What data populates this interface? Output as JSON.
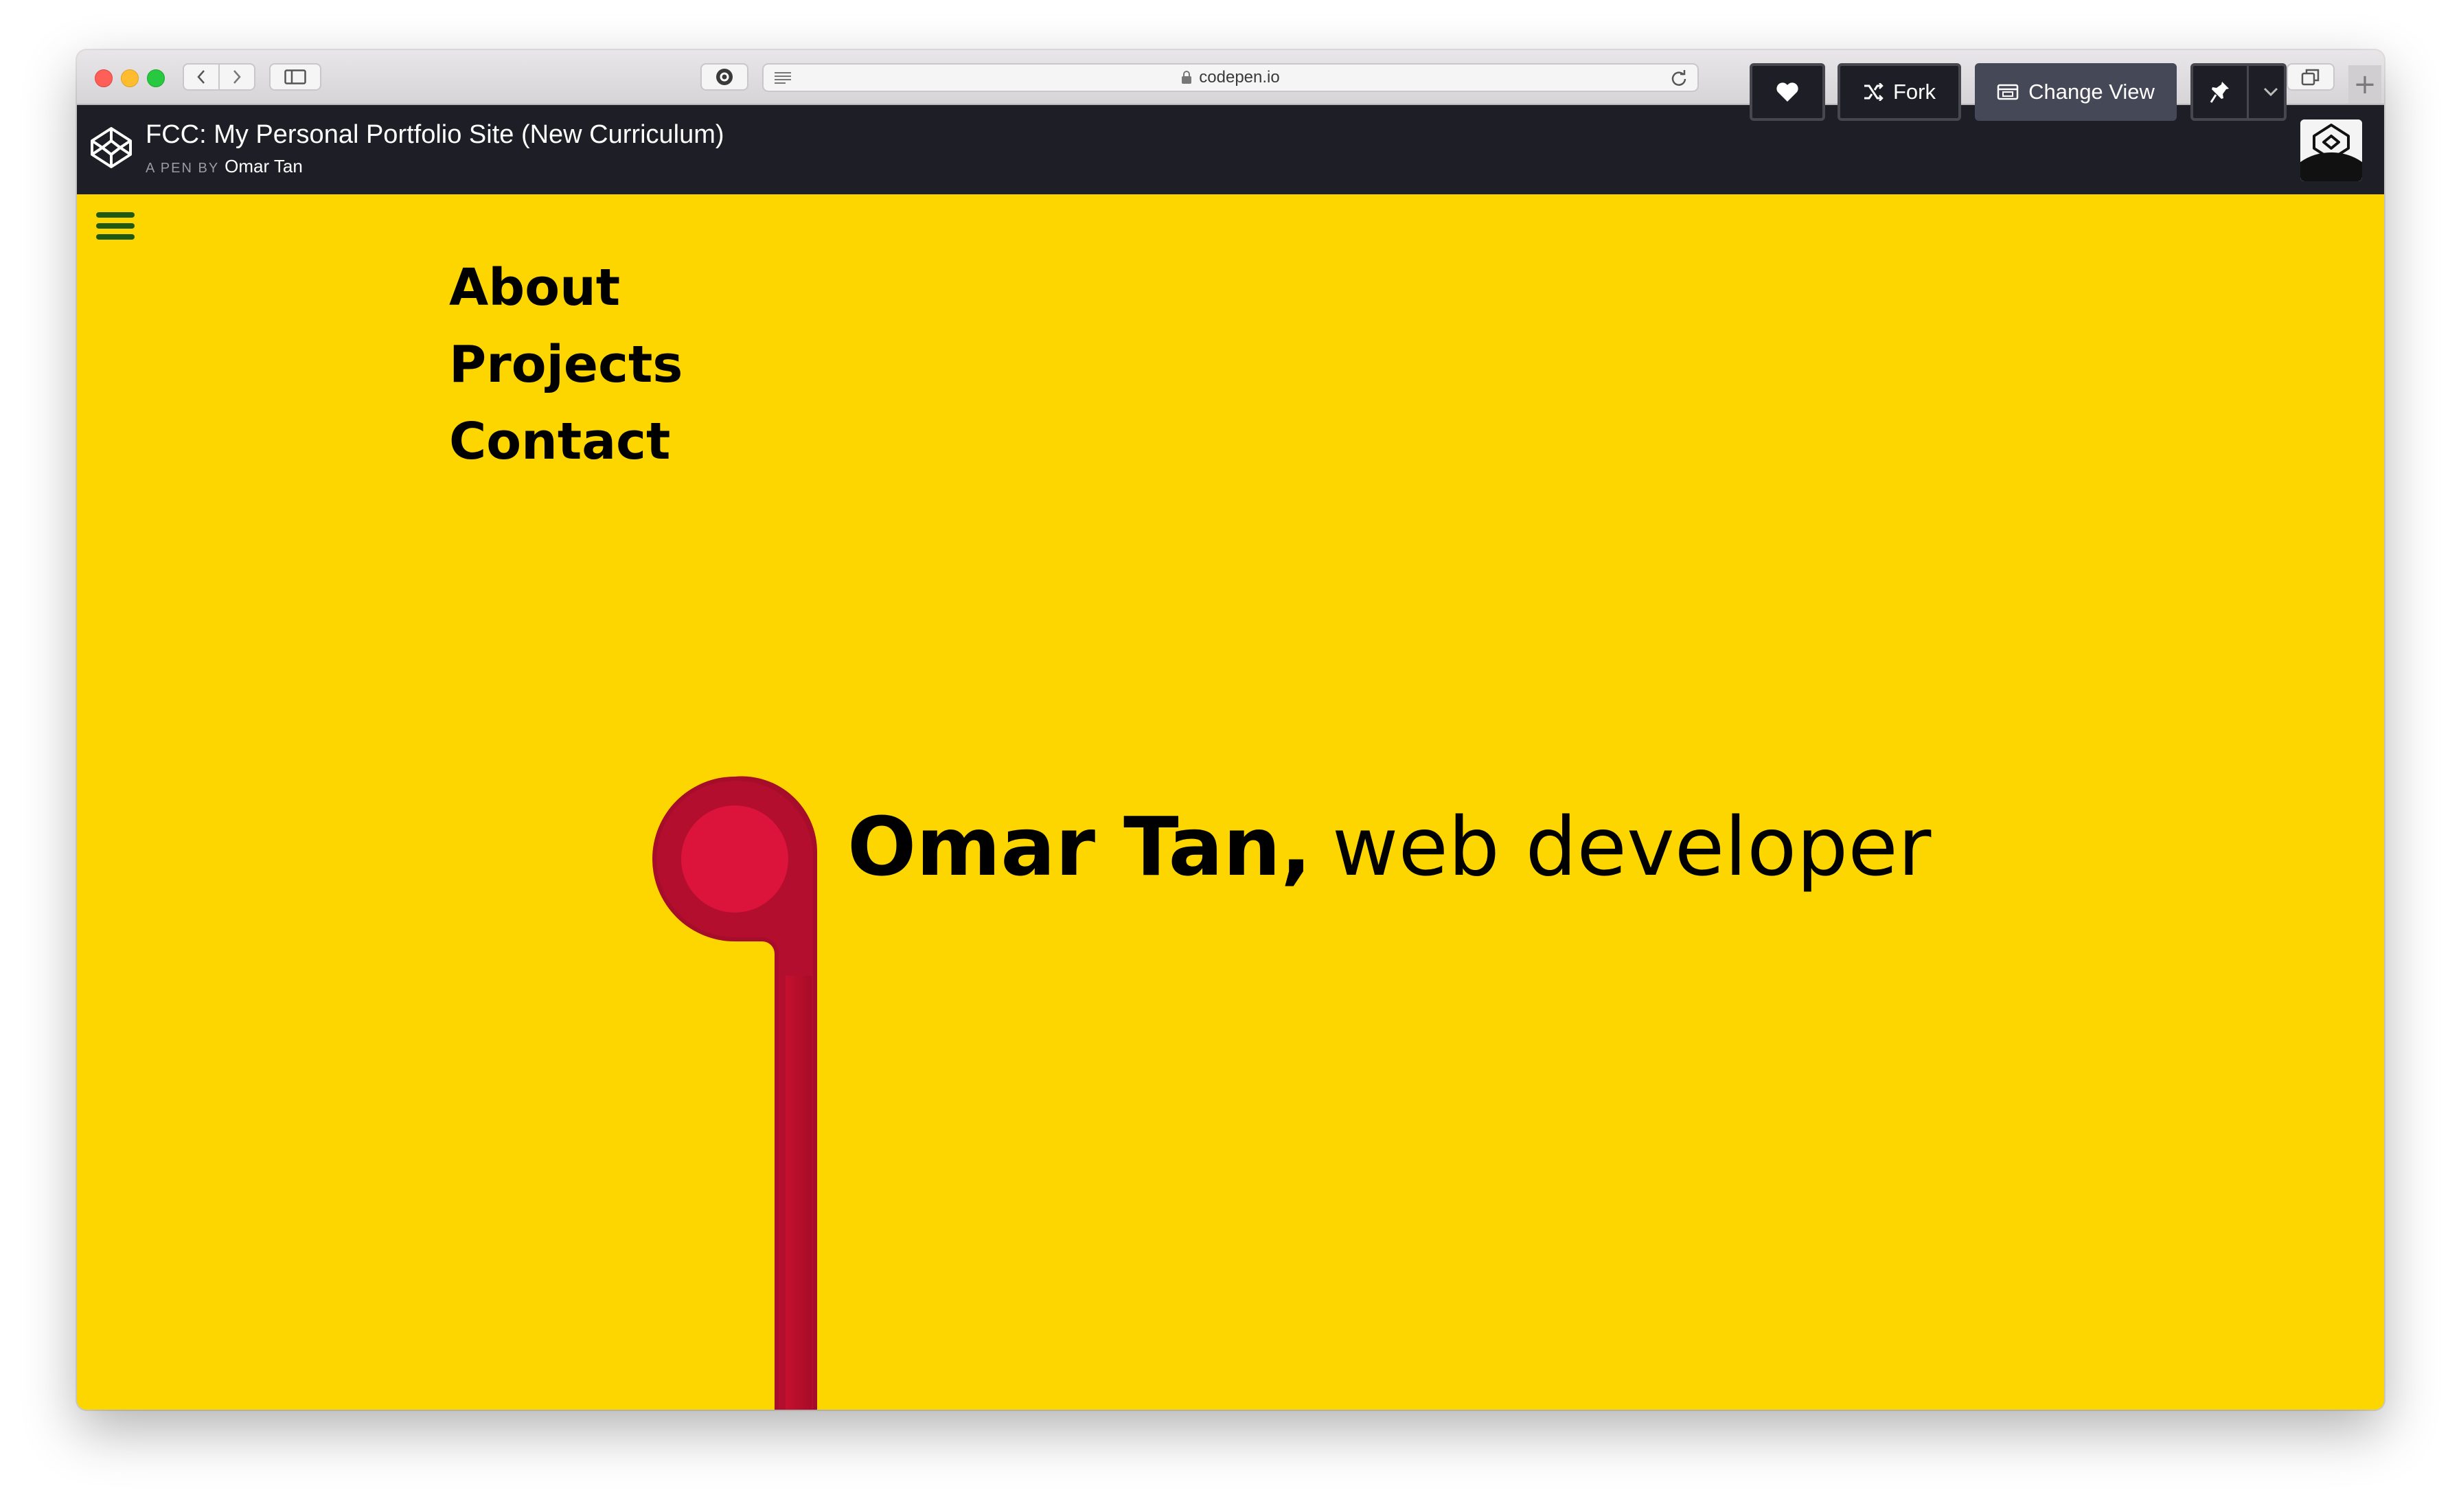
{
  "browser": {
    "url": "codepen.io"
  },
  "codepen": {
    "title": "FCC: My Personal Portfolio Site (New Curriculum)",
    "byline_label": "A PEN BY",
    "author": "Omar Tan",
    "buttons": {
      "fork": "Fork",
      "change_view": "Change View"
    }
  },
  "page": {
    "nav": [
      {
        "label": "About"
      },
      {
        "label": "Projects"
      },
      {
        "label": "Contact"
      }
    ],
    "hero": {
      "name": "Omar Tan,",
      "role": "web developer"
    }
  },
  "colors": {
    "page_background": "#fdd600",
    "accent_red": "#dc143c",
    "header_dark": "#1e1f26",
    "hamburger_green": "#1f5a12"
  },
  "icons": {
    "codepen_logo": "codepen-logo-icon",
    "heart": "heart-icon",
    "fork": "fork-icon",
    "change_view": "layout-icon",
    "pin": "pin-icon",
    "dropdown": "chevron-down-icon",
    "menu": "hamburger-menu-icon",
    "lock": "lock-icon",
    "reload": "reload-icon"
  }
}
